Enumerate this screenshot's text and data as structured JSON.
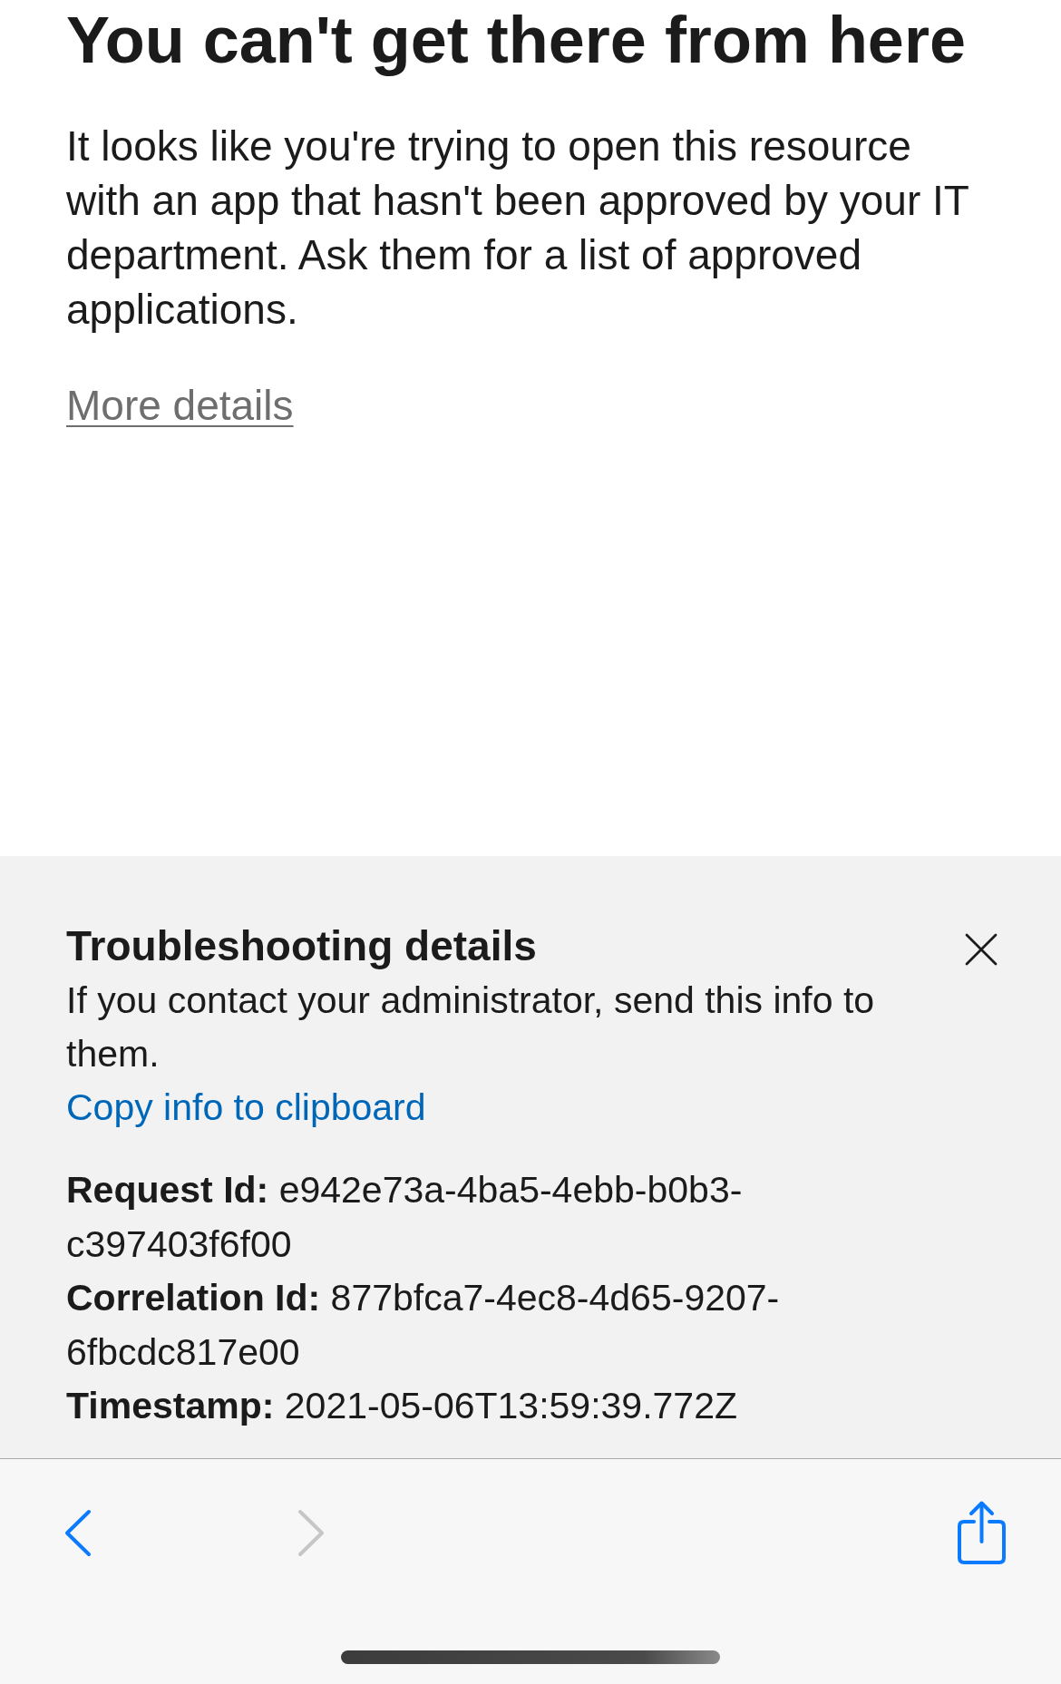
{
  "page": {
    "title": "You can't get there from here",
    "message": "It looks like you're trying to open this resource with an app that hasn't been approved by your IT department. Ask them for a list of approved applications.",
    "more_details_link": "More details"
  },
  "troubleshooting": {
    "title": "Troubleshooting details",
    "description": "If you contact your administrator, send this info to them.",
    "copy_link": "Copy info to clipboard",
    "details": [
      {
        "label": "Request Id:",
        "value": "e942e73a-4ba5-4ebb-b0b3-c397403f6f00"
      },
      {
        "label": "Correlation Id:",
        "value": "877bfca7-4ec8-4d65-9207-6fbcdc817e00"
      },
      {
        "label": "Timestamp:",
        "value": "2021-05-06T13:59:39.772Z"
      }
    ]
  },
  "toolbar": {
    "buttons": [
      {
        "kind": "back",
        "disabled": false
      },
      {
        "kind": "forward",
        "disabled": true
      },
      {
        "kind": "share",
        "disabled": false
      }
    ]
  }
}
